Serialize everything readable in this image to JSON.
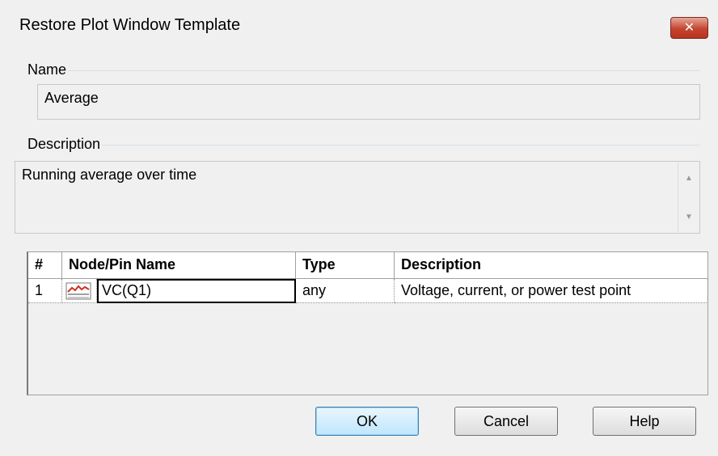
{
  "window": {
    "title": "Restore Plot Window Template",
    "close_glyph": "✕"
  },
  "name_group": {
    "label": "Name",
    "value": "Average"
  },
  "description_group": {
    "label": "Description",
    "value": "Running average over time",
    "scroll_up_glyph": "▲",
    "scroll_down_glyph": "▼"
  },
  "grid": {
    "columns": [
      "#",
      "Node/Pin Name",
      "Type",
      "Description"
    ],
    "rows": [
      {
        "index": "1",
        "icon": "waveform-plot-icon",
        "node": "VC(Q1)",
        "type": "any",
        "description": "Voltage, current, or power test point"
      }
    ]
  },
  "buttons": {
    "ok": "OK",
    "cancel": "Cancel",
    "help": "Help"
  },
  "colors": {
    "close_button": "#c4442f",
    "default_button_border": "#3c7fb1",
    "icon_trace": "#d03020"
  }
}
